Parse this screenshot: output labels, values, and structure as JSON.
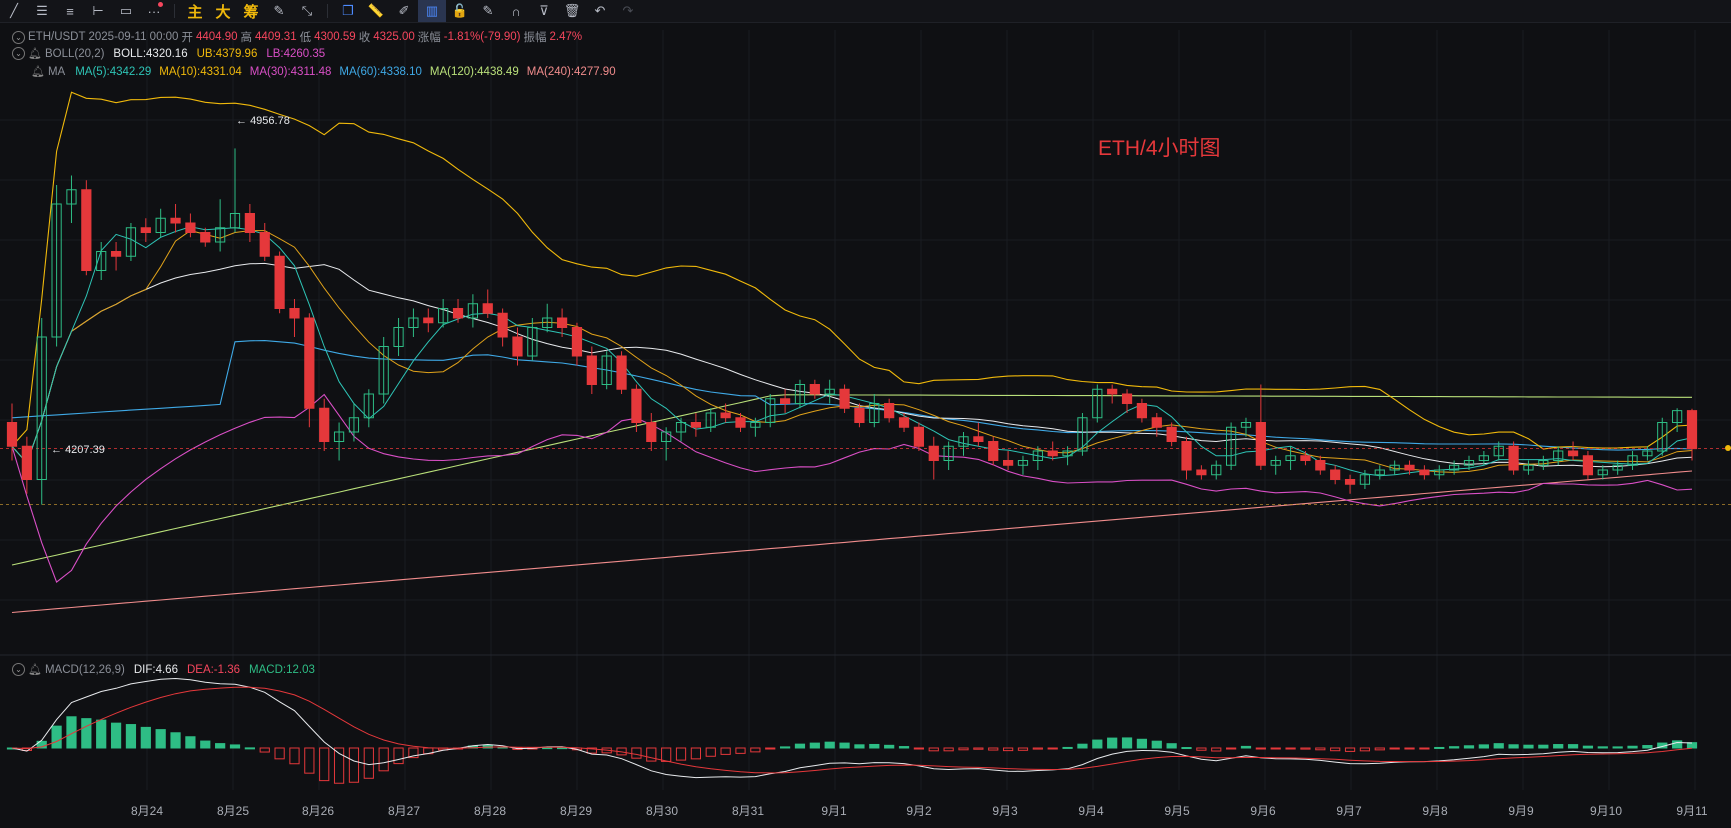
{
  "toolbar": {
    "tools": [
      {
        "name": "trend-line-icon",
        "glyph": "╱"
      },
      {
        "name": "horizontal-lines-icon",
        "glyph": "☰"
      },
      {
        "name": "menu-lines-icon",
        "glyph": "≡"
      },
      {
        "name": "horizontal-ray-icon",
        "glyph": "⊢"
      },
      {
        "name": "rectangle-icon",
        "glyph": "▭"
      },
      {
        "name": "more-icon",
        "glyph": "···"
      }
    ],
    "main_label": "主",
    "big_label": "大",
    "chip_label": "筹"
  },
  "header": {
    "symbol": "ETH/USDT",
    "datetime": "2025-09-11 00:00",
    "open_label": "开",
    "open": "4404.90",
    "high_label": "高",
    "high": "4409.31",
    "low_label": "低",
    "low": "4300.59",
    "close_label": "收",
    "close": "4325.00",
    "change_label": "涨幅",
    "change": "-1.81%(-79.90)",
    "amplitude_label": "振幅",
    "amplitude": "2.47%"
  },
  "boll": {
    "name": "BOLL(20,2)",
    "mid": "BOLL:4320.16",
    "ub": "UB:4379.96",
    "lb": "LB:4260.35"
  },
  "ma": {
    "name": "MA",
    "items": [
      {
        "label": "MA(5):4342.29",
        "color": "#2ec4b6"
      },
      {
        "label": "MA(10):4331.04",
        "color": "#f0b90b"
      },
      {
        "label": "MA(30):4311.48",
        "color": "#d94fc6"
      },
      {
        "label": "MA(60):4338.10",
        "color": "#3fa9e6"
      },
      {
        "label": "MA(120):4438.49",
        "color": "#b9e07a"
      },
      {
        "label": "MA(240):4277.90",
        "color": "#f08c8c"
      }
    ]
  },
  "macd": {
    "name": "MACD(12,26,9)",
    "dif": "DIF:4.66",
    "dea": "DEA:-1.36",
    "macd": "MACD:12.03"
  },
  "annotations": {
    "title": "ETH/4小时图",
    "high_label": "4956.78",
    "low_label": "4207.39"
  },
  "x_axis": [
    "8月24",
    "8月25",
    "8月26",
    "8月27",
    "8月28",
    "8月29",
    "8月30",
    "8月31",
    "9月1",
    "9月2",
    "9月3",
    "9月4",
    "9月5",
    "9月6",
    "9月7",
    "9月8",
    "9月9",
    "9月10",
    "9月11"
  ],
  "colors": {
    "up": "#2ebd85",
    "down": "#e5383b",
    "background": "#0f1013"
  },
  "chart_data": {
    "type": "candlestick",
    "interval": "4h",
    "candles_ohlc": [
      [
        4380,
        4420,
        4300,
        4330
      ],
      [
        4330,
        4350,
        4230,
        4260
      ],
      [
        4260,
        4600,
        4207,
        4560
      ],
      [
        4560,
        4880,
        4540,
        4840
      ],
      [
        4840,
        4900,
        4800,
        4870
      ],
      [
        4870,
        4890,
        4690,
        4700
      ],
      [
        4700,
        4760,
        4680,
        4740
      ],
      [
        4740,
        4760,
        4700,
        4730
      ],
      [
        4730,
        4800,
        4720,
        4790
      ],
      [
        4790,
        4810,
        4760,
        4780
      ],
      [
        4780,
        4830,
        4770,
        4810
      ],
      [
        4810,
        4840,
        4780,
        4800
      ],
      [
        4800,
        4820,
        4770,
        4780
      ],
      [
        4780,
        4790,
        4750,
        4760
      ],
      [
        4760,
        4850,
        4740,
        4790
      ],
      [
        4790,
        4957,
        4780,
        4820
      ],
      [
        4820,
        4840,
        4760,
        4780
      ],
      [
        4780,
        4800,
        4720,
        4730
      ],
      [
        4730,
        4740,
        4610,
        4620
      ],
      [
        4620,
        4640,
        4560,
        4600
      ],
      [
        4600,
        4610,
        4370,
        4410
      ],
      [
        4410,
        4430,
        4320,
        4340
      ],
      [
        4340,
        4380,
        4300,
        4360
      ],
      [
        4360,
        4420,
        4340,
        4390
      ],
      [
        4390,
        4450,
        4370,
        4440
      ],
      [
        4440,
        4560,
        4420,
        4540
      ],
      [
        4540,
        4600,
        4520,
        4580
      ],
      [
        4580,
        4620,
        4560,
        4600
      ],
      [
        4600,
        4620,
        4570,
        4590
      ],
      [
        4590,
        4640,
        4580,
        4620
      ],
      [
        4620,
        4640,
        4590,
        4600
      ],
      [
        4600,
        4650,
        4580,
        4630
      ],
      [
        4630,
        4660,
        4600,
        4610
      ],
      [
        4610,
        4620,
        4540,
        4560
      ],
      [
        4560,
        4580,
        4500,
        4520
      ],
      [
        4520,
        4600,
        4510,
        4580
      ],
      [
        4580,
        4630,
        4570,
        4600
      ],
      [
        4600,
        4620,
        4560,
        4580
      ],
      [
        4580,
        4590,
        4500,
        4520
      ],
      [
        4520,
        4540,
        4440,
        4460
      ],
      [
        4460,
        4530,
        4450,
        4520
      ],
      [
        4520,
        4530,
        4440,
        4450
      ],
      [
        4450,
        4460,
        4360,
        4380
      ],
      [
        4380,
        4400,
        4320,
        4340
      ],
      [
        4340,
        4370,
        4300,
        4360
      ],
      [
        4360,
        4390,
        4340,
        4380
      ],
      [
        4380,
        4400,
        4350,
        4370
      ],
      [
        4370,
        4410,
        4360,
        4400
      ],
      [
        4400,
        4420,
        4380,
        4390
      ],
      [
        4390,
        4400,
        4360,
        4370
      ],
      [
        4370,
        4390,
        4350,
        4380
      ],
      [
        4380,
        4440,
        4370,
        4430
      ],
      [
        4430,
        4450,
        4400,
        4420
      ],
      [
        4420,
        4470,
        4410,
        4460
      ],
      [
        4460,
        4470,
        4430,
        4440
      ],
      [
        4440,
        4470,
        4420,
        4450
      ],
      [
        4450,
        4460,
        4400,
        4410
      ],
      [
        4410,
        4420,
        4370,
        4380
      ],
      [
        4380,
        4440,
        4370,
        4420
      ],
      [
        4420,
        4430,
        4380,
        4390
      ],
      [
        4390,
        4400,
        4360,
        4370
      ],
      [
        4370,
        4380,
        4320,
        4330
      ],
      [
        4330,
        4350,
        4260,
        4300
      ],
      [
        4300,
        4340,
        4280,
        4330
      ],
      [
        4330,
        4360,
        4310,
        4350
      ],
      [
        4350,
        4380,
        4330,
        4340
      ],
      [
        4340,
        4350,
        4290,
        4300
      ],
      [
        4300,
        4320,
        4280,
        4290
      ],
      [
        4290,
        4310,
        4270,
        4300
      ],
      [
        4300,
        4330,
        4280,
        4320
      ],
      [
        4320,
        4340,
        4300,
        4310
      ],
      [
        4310,
        4330,
        4290,
        4320
      ],
      [
        4320,
        4400,
        4310,
        4390
      ],
      [
        4390,
        4460,
        4380,
        4450
      ],
      [
        4450,
        4460,
        4420,
        4440
      ],
      [
        4440,
        4450,
        4400,
        4420
      ],
      [
        4420,
        4430,
        4380,
        4390
      ],
      [
        4390,
        4400,
        4350,
        4370
      ],
      [
        4370,
        4380,
        4330,
        4340
      ],
      [
        4340,
        4350,
        4260,
        4280
      ],
      [
        4280,
        4290,
        4260,
        4270
      ],
      [
        4270,
        4300,
        4260,
        4290
      ],
      [
        4290,
        4380,
        4280,
        4370
      ],
      [
        4370,
        4390,
        4350,
        4380
      ],
      [
        4380,
        4460,
        4280,
        4290
      ],
      [
        4290,
        4310,
        4270,
        4300
      ],
      [
        4300,
        4330,
        4280,
        4310
      ],
      [
        4310,
        4320,
        4290,
        4300
      ],
      [
        4300,
        4310,
        4270,
        4280
      ],
      [
        4280,
        4290,
        4250,
        4260
      ],
      [
        4260,
        4270,
        4230,
        4250
      ],
      [
        4250,
        4280,
        4240,
        4270
      ],
      [
        4270,
        4290,
        4260,
        4280
      ],
      [
        4280,
        4300,
        4270,
        4290
      ],
      [
        4290,
        4300,
        4270,
        4280
      ],
      [
        4280,
        4290,
        4260,
        4270
      ],
      [
        4270,
        4290,
        4260,
        4280
      ],
      [
        4280,
        4300,
        4270,
        4290
      ],
      [
        4290,
        4310,
        4280,
        4300
      ],
      [
        4300,
        4320,
        4290,
        4310
      ],
      [
        4310,
        4340,
        4300,
        4330
      ],
      [
        4330,
        4340,
        4270,
        4280
      ],
      [
        4280,
        4300,
        4270,
        4290
      ],
      [
        4290,
        4310,
        4280,
        4300
      ],
      [
        4300,
        4330,
        4290,
        4320
      ],
      [
        4320,
        4340,
        4300,
        4310
      ],
      [
        4310,
        4320,
        4260,
        4270
      ],
      [
        4270,
        4290,
        4260,
        4280
      ],
      [
        4280,
        4300,
        4270,
        4290
      ],
      [
        4290,
        4320,
        4280,
        4310
      ],
      [
        4310,
        4330,
        4300,
        4320
      ],
      [
        4320,
        4390,
        4310,
        4380
      ],
      [
        4380,
        4410,
        4360,
        4405
      ],
      [
        4405,
        4409,
        4300,
        4325
      ]
    ],
    "ma5_last": 4342.29,
    "ma10_last": 4331.04,
    "ma30_last": 4311.48,
    "ma60_last": 4338.1,
    "ma120_last": 4438.49,
    "ma240_last": 4277.9,
    "boll_mid": 4320.16,
    "boll_ub": 4379.96,
    "boll_lb": 4260.35,
    "highest": 4956.78,
    "lowest": 4207.39,
    "macd_dif": 4.66,
    "macd_dea": -1.36,
    "macd_hist": 12.03
  }
}
